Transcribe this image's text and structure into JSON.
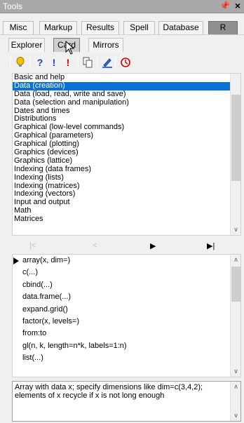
{
  "window": {
    "title": "Tools",
    "pin_glyph": "\u0003",
    "close_glyph": "✕"
  },
  "top_tabs": [
    {
      "label": "Misc"
    },
    {
      "label": "Markup"
    },
    {
      "label": "Results"
    },
    {
      "label": "Spell"
    },
    {
      "label": "Database"
    },
    {
      "label": "R",
      "active": true
    }
  ],
  "sub_tabs": [
    {
      "label": "Explorer"
    },
    {
      "label": "Card",
      "active": true
    },
    {
      "label": "Mirrors"
    }
  ],
  "toolbar": {
    "icons": [
      "lightbulb-icon",
      "help-icon",
      "exclamation-icon",
      "exclamation-red-icon",
      "copy-icon",
      "edit-icon",
      "history-icon"
    ],
    "colors": {
      "accent": "#0a70d6",
      "red": "#d00000",
      "yellow": "#f2c200"
    }
  },
  "topics": {
    "items": [
      "Basic and help",
      "Data (creation)",
      "Data (load, read, write and save)",
      "Data (selection and manipulation)",
      "Dates and times",
      "Distributions",
      "Graphical (low-level commands)",
      "Graphical (parameters)",
      "Graphical (plotting)",
      "Graphics (devices)",
      "Graphics (lattice)",
      "Indexing (data frames)",
      "Indexing (lists)",
      "Indexing (matrices)",
      "Indexing (vectors)",
      "Input and output",
      "Math",
      "Matrices"
    ],
    "selected_index": 1
  },
  "nav": {
    "first": "|<",
    "prev": "<",
    "next": "▶",
    "last": "▶|"
  },
  "functions": {
    "items": [
      "array(x, dim=)",
      "c(...)",
      "cbind(...)",
      "data.frame(...)",
      "expand.grid()",
      "factor(x, levels=)",
      "from:to",
      "gl(n, k, length=n*k, labels=1:n)",
      "list(...)"
    ],
    "current_index": 0
  },
  "description": {
    "text": "Array with data x; specify dimensions like dim=c(3,4,2); elements of x recycle if x is not long enough"
  }
}
